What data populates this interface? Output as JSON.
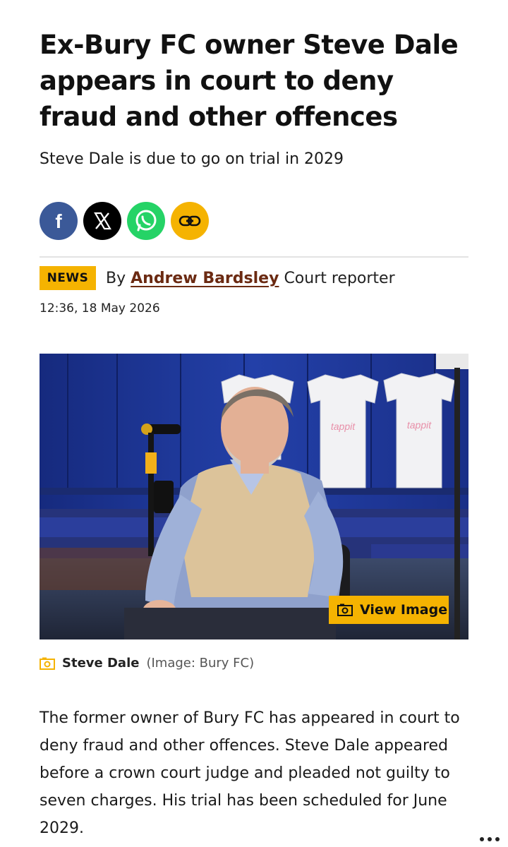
{
  "article": {
    "headline": "Ex-Bury FC owner Steve Dale appears in court to deny fraud and other offences",
    "standfirst": "Steve Dale is due to go on trial in 2029",
    "share": [
      {
        "icon": "facebook-icon",
        "color": "#3b5998"
      },
      {
        "icon": "x-icon",
        "color": "#000000"
      },
      {
        "icon": "whatsapp-icon",
        "color": "#25d366"
      },
      {
        "icon": "link-icon",
        "color": "#f5b301"
      }
    ],
    "tag": "NEWS",
    "by_prefix": "By",
    "author": "Andrew Bardsley",
    "author_role": "Court reporter",
    "date": "12:36, 18 May 2026",
    "image": {
      "view_label": "View Image",
      "caption_name": "Steve Dale",
      "caption_credit": "(Image: Bury FC)",
      "shirt_sponsor": "tappit"
    },
    "body": "The former owner of Bury FC has appeared in court to deny fraud and other offences. Steve Dale appeared before a crown court judge and pleaded not guilty to seven charges. His trial has been scheduled for June 2029."
  },
  "colors": {
    "accent": "#f5b301",
    "author": "#6b2a12"
  }
}
